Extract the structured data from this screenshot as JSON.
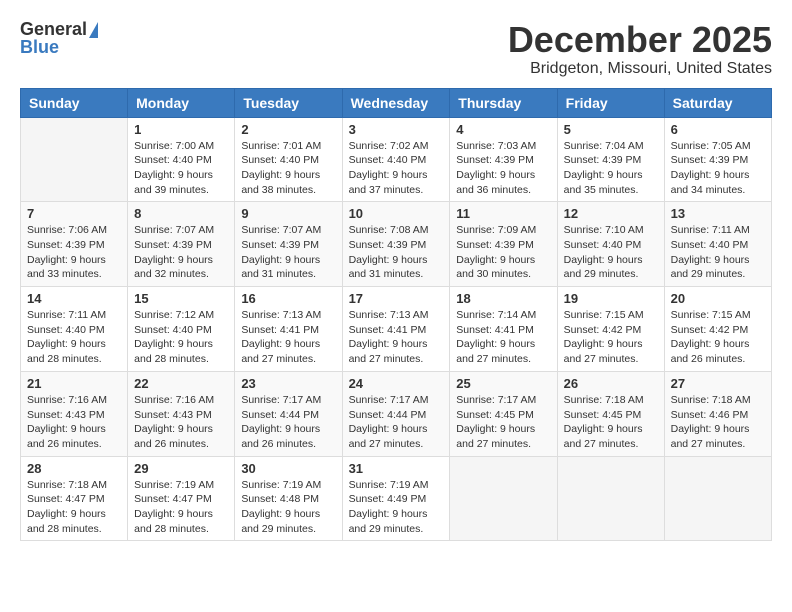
{
  "header": {
    "logo": {
      "general": "General",
      "blue": "Blue",
      "icon": "▶"
    },
    "month_title": "December 2025",
    "location": "Bridgeton, Missouri, United States"
  },
  "weekdays": [
    "Sunday",
    "Monday",
    "Tuesday",
    "Wednesday",
    "Thursday",
    "Friday",
    "Saturday"
  ],
  "weeks": [
    [
      {
        "day": "",
        "info": ""
      },
      {
        "day": "1",
        "info": "Sunrise: 7:00 AM\nSunset: 4:40 PM\nDaylight: 9 hours\nand 39 minutes."
      },
      {
        "day": "2",
        "info": "Sunrise: 7:01 AM\nSunset: 4:40 PM\nDaylight: 9 hours\nand 38 minutes."
      },
      {
        "day": "3",
        "info": "Sunrise: 7:02 AM\nSunset: 4:40 PM\nDaylight: 9 hours\nand 37 minutes."
      },
      {
        "day": "4",
        "info": "Sunrise: 7:03 AM\nSunset: 4:39 PM\nDaylight: 9 hours\nand 36 minutes."
      },
      {
        "day": "5",
        "info": "Sunrise: 7:04 AM\nSunset: 4:39 PM\nDaylight: 9 hours\nand 35 minutes."
      },
      {
        "day": "6",
        "info": "Sunrise: 7:05 AM\nSunset: 4:39 PM\nDaylight: 9 hours\nand 34 minutes."
      }
    ],
    [
      {
        "day": "7",
        "info": "Sunrise: 7:06 AM\nSunset: 4:39 PM\nDaylight: 9 hours\nand 33 minutes."
      },
      {
        "day": "8",
        "info": "Sunrise: 7:07 AM\nSunset: 4:39 PM\nDaylight: 9 hours\nand 32 minutes."
      },
      {
        "day": "9",
        "info": "Sunrise: 7:07 AM\nSunset: 4:39 PM\nDaylight: 9 hours\nand 31 minutes."
      },
      {
        "day": "10",
        "info": "Sunrise: 7:08 AM\nSunset: 4:39 PM\nDaylight: 9 hours\nand 31 minutes."
      },
      {
        "day": "11",
        "info": "Sunrise: 7:09 AM\nSunset: 4:39 PM\nDaylight: 9 hours\nand 30 minutes."
      },
      {
        "day": "12",
        "info": "Sunrise: 7:10 AM\nSunset: 4:40 PM\nDaylight: 9 hours\nand 29 minutes."
      },
      {
        "day": "13",
        "info": "Sunrise: 7:11 AM\nSunset: 4:40 PM\nDaylight: 9 hours\nand 29 minutes."
      }
    ],
    [
      {
        "day": "14",
        "info": "Sunrise: 7:11 AM\nSunset: 4:40 PM\nDaylight: 9 hours\nand 28 minutes."
      },
      {
        "day": "15",
        "info": "Sunrise: 7:12 AM\nSunset: 4:40 PM\nDaylight: 9 hours\nand 28 minutes."
      },
      {
        "day": "16",
        "info": "Sunrise: 7:13 AM\nSunset: 4:41 PM\nDaylight: 9 hours\nand 27 minutes."
      },
      {
        "day": "17",
        "info": "Sunrise: 7:13 AM\nSunset: 4:41 PM\nDaylight: 9 hours\nand 27 minutes."
      },
      {
        "day": "18",
        "info": "Sunrise: 7:14 AM\nSunset: 4:41 PM\nDaylight: 9 hours\nand 27 minutes."
      },
      {
        "day": "19",
        "info": "Sunrise: 7:15 AM\nSunset: 4:42 PM\nDaylight: 9 hours\nand 27 minutes."
      },
      {
        "day": "20",
        "info": "Sunrise: 7:15 AM\nSunset: 4:42 PM\nDaylight: 9 hours\nand 26 minutes."
      }
    ],
    [
      {
        "day": "21",
        "info": "Sunrise: 7:16 AM\nSunset: 4:43 PM\nDaylight: 9 hours\nand 26 minutes."
      },
      {
        "day": "22",
        "info": "Sunrise: 7:16 AM\nSunset: 4:43 PM\nDaylight: 9 hours\nand 26 minutes."
      },
      {
        "day": "23",
        "info": "Sunrise: 7:17 AM\nSunset: 4:44 PM\nDaylight: 9 hours\nand 26 minutes."
      },
      {
        "day": "24",
        "info": "Sunrise: 7:17 AM\nSunset: 4:44 PM\nDaylight: 9 hours\nand 27 minutes."
      },
      {
        "day": "25",
        "info": "Sunrise: 7:17 AM\nSunset: 4:45 PM\nDaylight: 9 hours\nand 27 minutes."
      },
      {
        "day": "26",
        "info": "Sunrise: 7:18 AM\nSunset: 4:45 PM\nDaylight: 9 hours\nand 27 minutes."
      },
      {
        "day": "27",
        "info": "Sunrise: 7:18 AM\nSunset: 4:46 PM\nDaylight: 9 hours\nand 27 minutes."
      }
    ],
    [
      {
        "day": "28",
        "info": "Sunrise: 7:18 AM\nSunset: 4:47 PM\nDaylight: 9 hours\nand 28 minutes."
      },
      {
        "day": "29",
        "info": "Sunrise: 7:19 AM\nSunset: 4:47 PM\nDaylight: 9 hours\nand 28 minutes."
      },
      {
        "day": "30",
        "info": "Sunrise: 7:19 AM\nSunset: 4:48 PM\nDaylight: 9 hours\nand 29 minutes."
      },
      {
        "day": "31",
        "info": "Sunrise: 7:19 AM\nSunset: 4:49 PM\nDaylight: 9 hours\nand 29 minutes."
      },
      {
        "day": "",
        "info": ""
      },
      {
        "day": "",
        "info": ""
      },
      {
        "day": "",
        "info": ""
      }
    ]
  ]
}
